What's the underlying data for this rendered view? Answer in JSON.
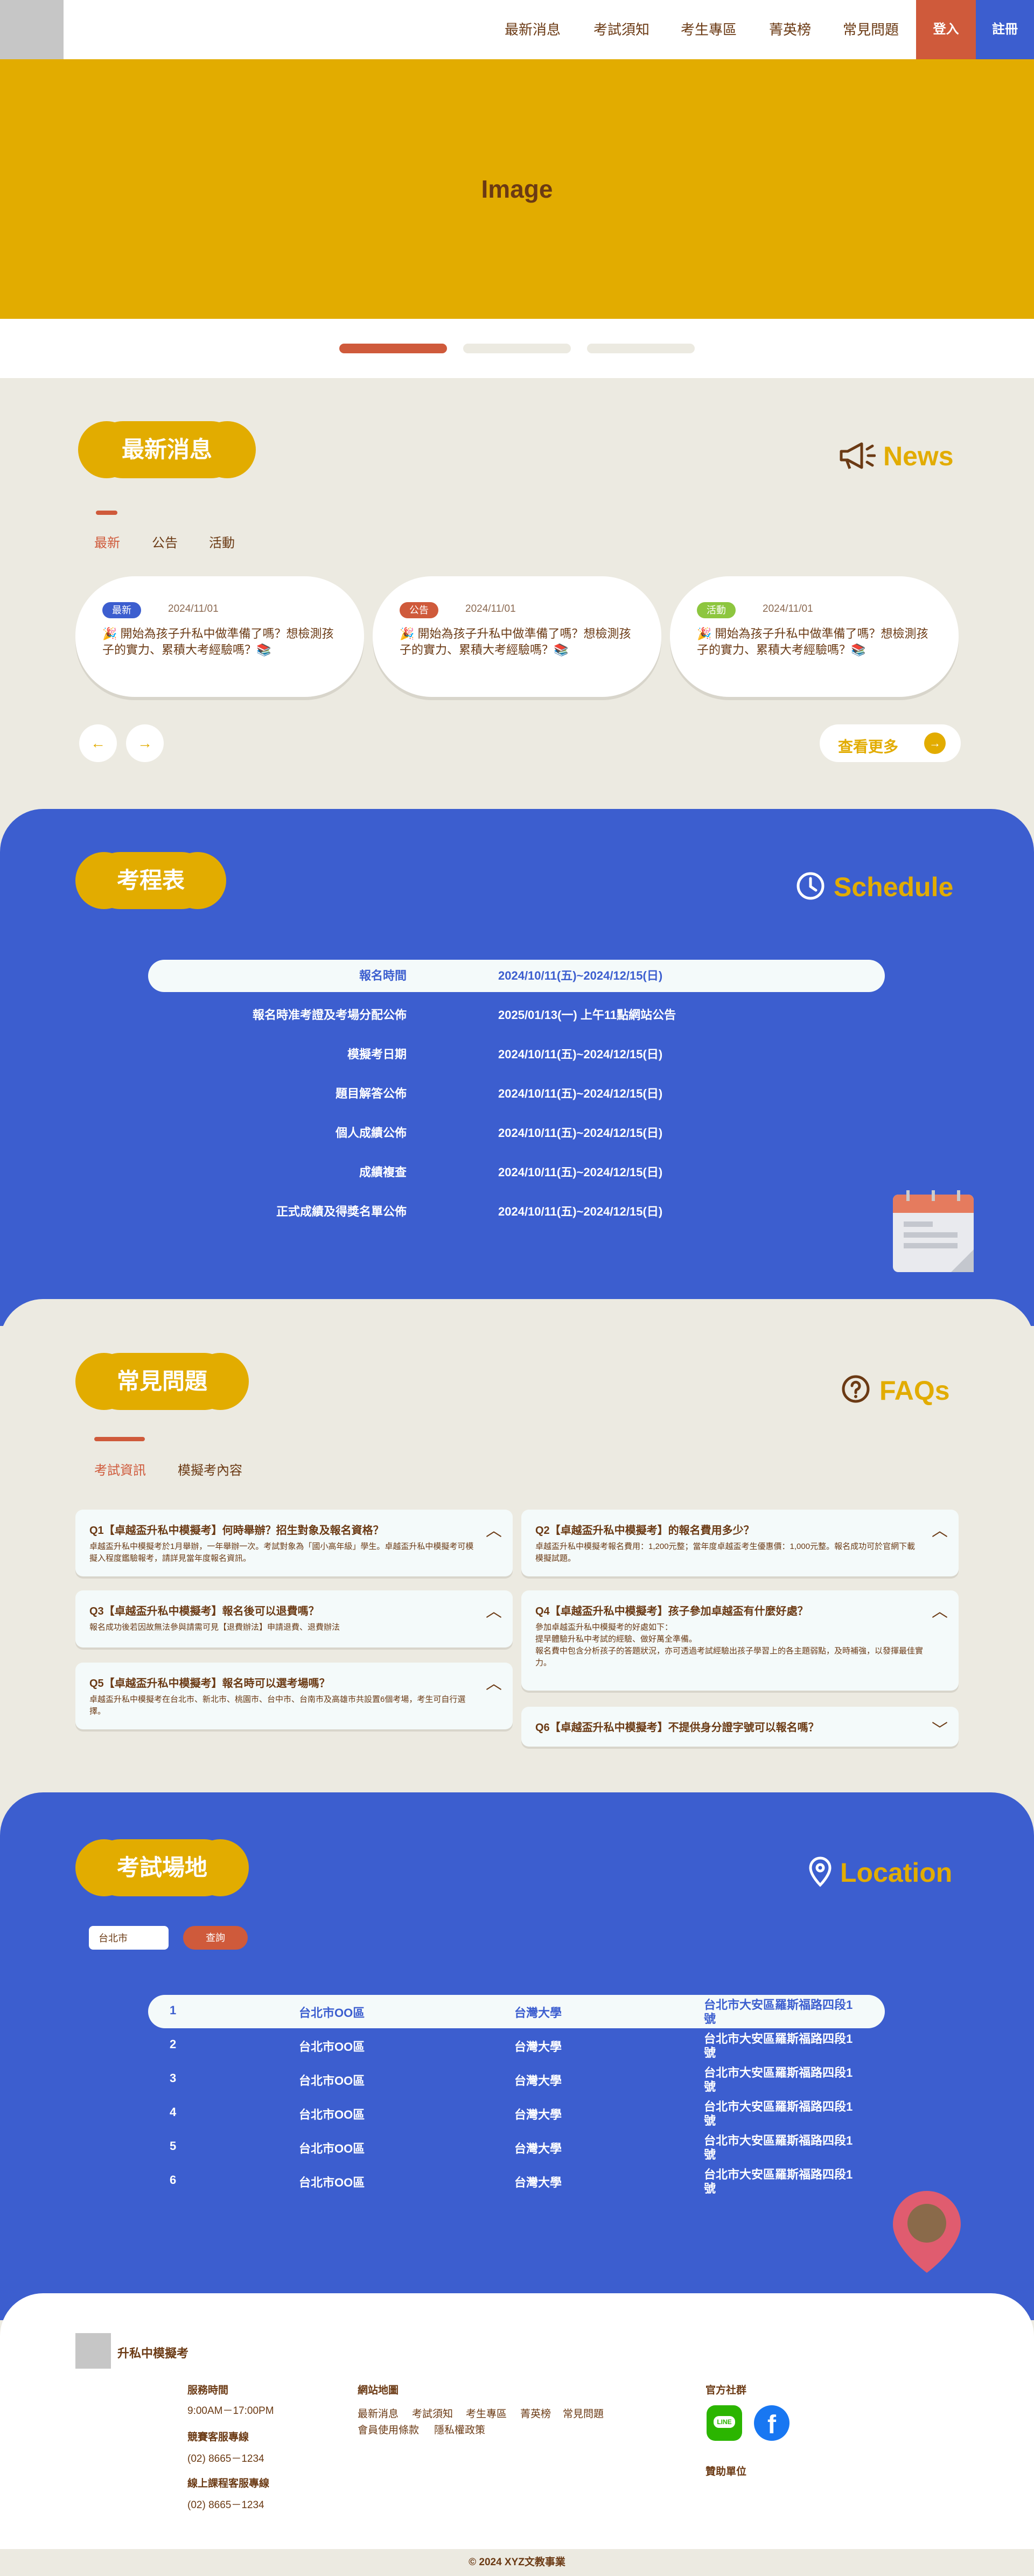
{
  "nav": {
    "items": [
      "最新消息",
      "考試須知",
      "考生專區",
      "菁英榜",
      "常見問題"
    ],
    "login": "登入",
    "register": "註冊"
  },
  "hero": {
    "placeholder": "Image"
  },
  "news": {
    "title": "最新消息",
    "eng": "News",
    "tabs": [
      "最新",
      "公告",
      "活動"
    ],
    "cards": [
      {
        "badge": "最新",
        "date": "2024/11/01",
        "text": "🎉 開始為孩子升私中做準備了嗎？想檢測孩子的實力、累積大考經驗嗎？📚",
        "color": "#3C5ECF"
      },
      {
        "badge": "公告",
        "date": "2024/11/01",
        "text": "🎉 開始為孩子升私中做準備了嗎？想檢測孩子的實力、累積大考經驗嗎？📚",
        "color": "#CF5A3B"
      },
      {
        "badge": "活動",
        "date": "2024/11/01",
        "text": "🎉 開始為孩子升私中做準備了嗎？想檢測孩子的實力、累積大考經驗嗎？📚",
        "color": "#8DC63F"
      }
    ],
    "more": "查看更多"
  },
  "schedule": {
    "title": "考程表",
    "eng": "Schedule",
    "rows": [
      {
        "label": "報名時間",
        "value": "2024/10/11(五)~2024/12/15(日)"
      },
      {
        "label": "報名時准考證及考場分配公佈",
        "value": "2025/01/13(一) 上午11點網站公告"
      },
      {
        "label": "模擬考日期",
        "value": "2024/10/11(五)~2024/12/15(日)"
      },
      {
        "label": "題目解答公佈",
        "value": "2024/10/11(五)~2024/12/15(日)"
      },
      {
        "label": "個人成績公佈",
        "value": "2024/10/11(五)~2024/12/15(日)"
      },
      {
        "label": "成績複查",
        "value": "2024/10/11(五)~2024/12/15(日)"
      },
      {
        "label": "正式成績及得獎名單公佈",
        "value": "2024/10/11(五)~2024/12/15(日)"
      }
    ]
  },
  "faq": {
    "title": "常見問題",
    "eng": "FAQs",
    "tabs": [
      "考試資訊",
      "模擬考內容"
    ],
    "items": [
      {
        "q": "Q1【卓越盃升私中模擬考】何時舉辦？招生對象及報名資格？",
        "a": "卓越盃升私中模擬考於1月舉辦，一年舉辦一次。考試對象為「國小高年級」學生。卓越盃升私中模擬考可模擬入程度鑑驗報考，請詳見當年度報名資訊。"
      },
      {
        "q": "Q2【卓越盃升私中模擬考】的報名費用多少？",
        "a": "卓越盃升私中模擬考報名費用：1,200元整；當年度卓越盃考生優惠價：1,000元整。報名成功可於官網下載模擬試題。"
      },
      {
        "q": "Q3【卓越盃升私中模擬考】報名後可以退費嗎？",
        "a": "報名成功後若因故無法參與請需可見【退費辦法】申請退費、退費辦法"
      },
      {
        "q": "Q4【卓越盃升私中模擬考】孩子參加卓越盃有什麼好處？",
        "a": "參加卓越盃升私中模擬考的好處如下：\n提早體驗升私中考試的經驗、做好萬全準備。\n報名費中包含分析孩子的答題狀況，亦可透過考試經驗出孩子學習上的各主題弱點，及時補強，以發揮最佳實力。"
      },
      {
        "q": "Q5【卓越盃升私中模擬考】報名時可以選考場嗎？",
        "a": "卓越盃升私中模擬考在台北市、新北市、桃園市、台中市、台南市及高雄市共設置6個考場，考生可自行選擇。"
      },
      {
        "q": "Q6【卓越盃升私中模擬考】不提供身分證字號可以報名嗎？",
        "a": ""
      }
    ]
  },
  "location": {
    "title": "考試場地",
    "eng": "Location",
    "search_value": "台北市",
    "search_btn": "查詢",
    "rows": [
      [
        "1",
        "台北市OO區",
        "台灣大學",
        "台北市大安區羅斯福路四段1號"
      ],
      [
        "2",
        "台北市OO區",
        "台灣大學",
        "台北市大安區羅斯福路四段1號"
      ],
      [
        "3",
        "台北市OO區",
        "台灣大學",
        "台北市大安區羅斯福路四段1號"
      ],
      [
        "4",
        "台北市OO區",
        "台灣大學",
        "台北市大安區羅斯福路四段1號"
      ],
      [
        "5",
        "台北市OO區",
        "台灣大學",
        "台北市大安區羅斯福路四段1號"
      ],
      [
        "6",
        "台北市OO區",
        "台灣大學",
        "台北市大安區羅斯福路四段1號"
      ]
    ]
  },
  "footer": {
    "brand": "升私中模擬考",
    "service": {
      "h": "服務時間",
      "t": "9:00AM－17:00PM"
    },
    "hotline": {
      "h": "競賽客服專線",
      "t": "(02) 8665－1234"
    },
    "online": {
      "h": "線上課程客服專線",
      "t": "(02) 8665－1234"
    },
    "sitemap": {
      "h": "網站地圖",
      "links1": [
        "最新消息",
        "考試須知",
        "考生專區",
        "菁英榜",
        "常見問題"
      ],
      "links2": [
        "會員使用條款",
        "隱私權政策"
      ]
    },
    "social": {
      "h": "官方社群",
      "line": "LINE"
    },
    "sponsor": {
      "h": "贊助單位"
    },
    "copyright": "© 2024 XYZ文教事業"
  }
}
